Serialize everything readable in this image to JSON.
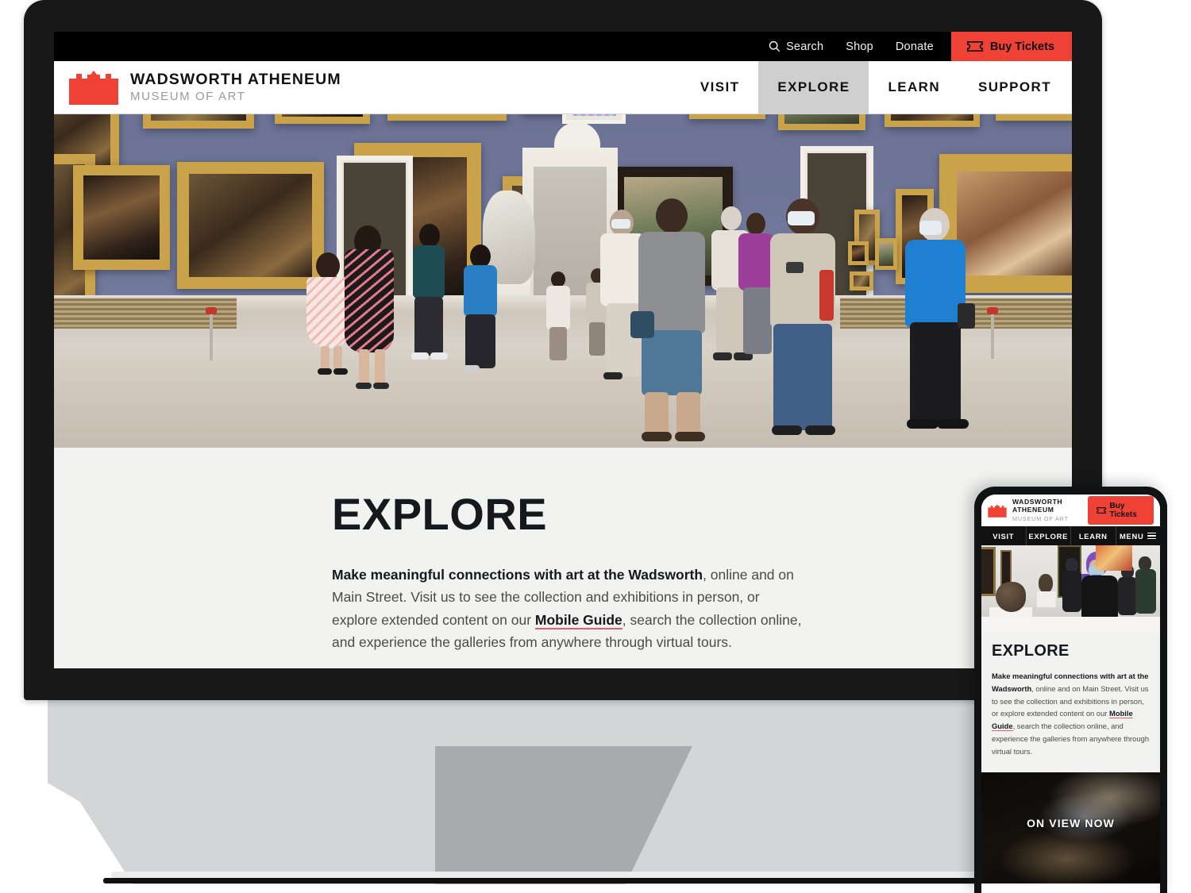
{
  "utility": {
    "search_label": "Search",
    "shop_label": "Shop",
    "donate_label": "Donate",
    "buy_tickets_label": "Buy Tickets"
  },
  "brand": {
    "title": "WADSWORTH ATHENEUM",
    "subtitle": "MUSEUM OF ART"
  },
  "nav": {
    "items": [
      {
        "label": "VISIT",
        "active": false
      },
      {
        "label": "EXPLORE",
        "active": true
      },
      {
        "label": "LEARN",
        "active": false
      },
      {
        "label": "SUPPORT",
        "active": false
      }
    ]
  },
  "explore": {
    "title": "EXPLORE",
    "lead_bold": "Make meaningful connections with art at the Wadsworth",
    "text_part1": ", online and on Main Street. Visit us to see the collection and exhibitions in person, or explore extended content on our ",
    "link_label": "Mobile Guide",
    "text_part2": ", search the collection online, and experience the galleries from anywhere through virtual tours."
  },
  "mobile": {
    "brand_title": "WADSWORTH ATHENEUM",
    "brand_subtitle": "MUSEUM OF ART",
    "buy_tickets_label": "Buy Tickets",
    "nav": [
      {
        "label": "VISIT"
      },
      {
        "label": "EXPLORE"
      },
      {
        "label": "LEARN"
      },
      {
        "label": "MENU"
      }
    ],
    "explore_title": "EXPLORE",
    "lead_bold": "Make meaningful connections with art at the Wadsworth",
    "text_part1": ", online and on Main Street. Visit us to see the collection and exhibitions in person, or explore extended content on our ",
    "link_label": "Mobile Guide",
    "text_part2": ", search the collection online, and experience the galleries from anywhere through virtual tours.",
    "on_view_label": "ON VIEW NOW"
  },
  "colors": {
    "brand_red": "#ef4136",
    "link_underline": "#e4606d",
    "nav_active_bg": "#cfcfcf",
    "section_bg": "#f2f2f0",
    "gallery_wall": "#6c7396",
    "bezel": "#181818"
  }
}
